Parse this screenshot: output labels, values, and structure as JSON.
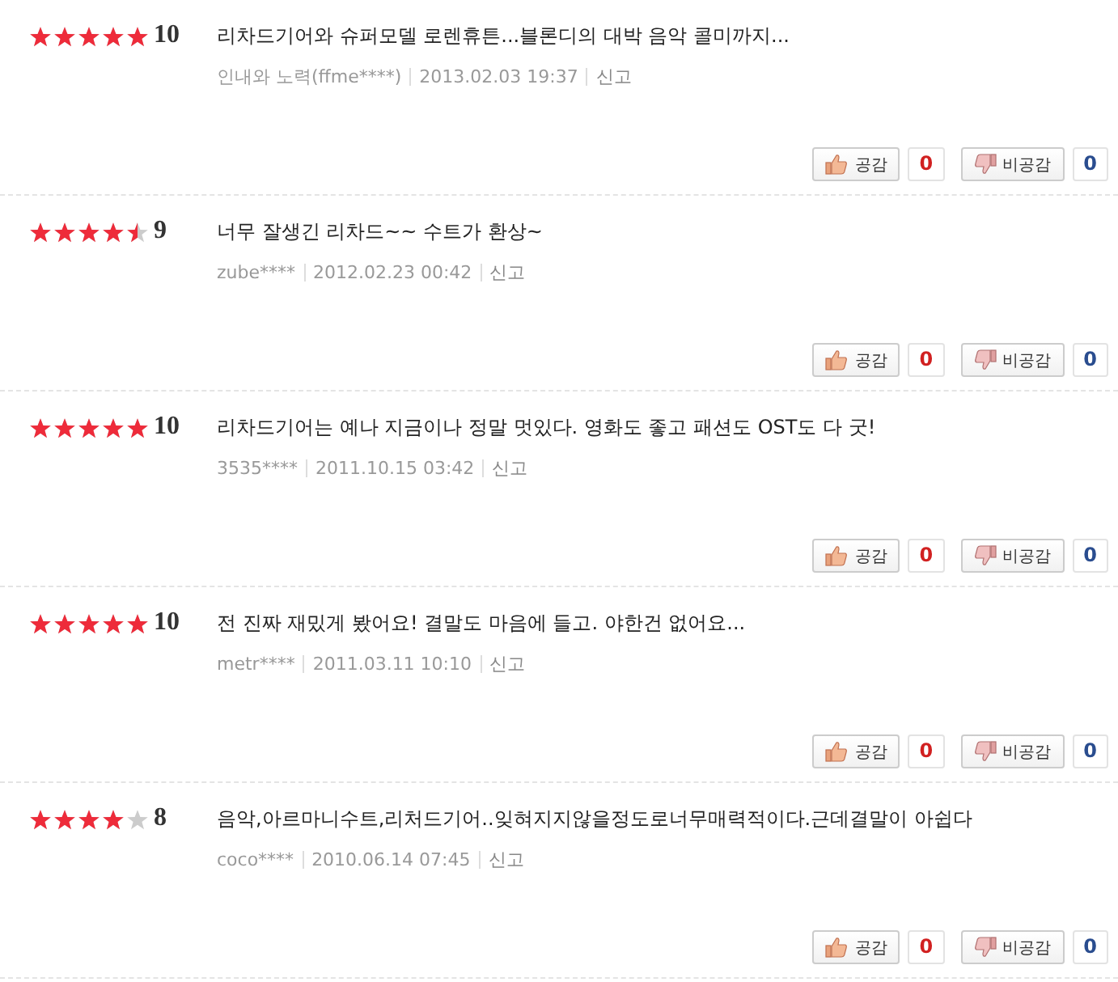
{
  "reviews": [
    {
      "stars": 5,
      "score": "10",
      "text": "리차드기어와 슈퍼모델 로렌휴튼...블론디의 대박 음악 콜미까지...",
      "author": "인내와 노력(ffme****)",
      "date": "2013.02.03 19:37",
      "report": "신고",
      "like_label": "공감",
      "like_count": "0",
      "dislike_label": "비공감",
      "dislike_count": "0"
    },
    {
      "stars": 4.5,
      "score": "9",
      "text": "너무 잘생긴 리차드~~ 수트가 환상~",
      "author": "zube****",
      "date": "2012.02.23 00:42",
      "report": "신고",
      "like_label": "공감",
      "like_count": "0",
      "dislike_label": "비공감",
      "dislike_count": "0"
    },
    {
      "stars": 5,
      "score": "10",
      "text": "리차드기어는 예나 지금이나 정말 멋있다. 영화도 좋고 패션도 OST도 다 굿!",
      "author": "3535****",
      "date": "2011.10.15 03:42",
      "report": "신고",
      "like_label": "공감",
      "like_count": "0",
      "dislike_label": "비공감",
      "dislike_count": "0"
    },
    {
      "stars": 5,
      "score": "10",
      "text": "전 진짜 재밌게 봤어요! 결말도 마음에 들고. 야한건 없어요...",
      "author": "metr****",
      "date": "2011.03.11 10:10",
      "report": "신고",
      "like_label": "공감",
      "like_count": "0",
      "dislike_label": "비공감",
      "dislike_count": "0"
    },
    {
      "stars": 4,
      "score": "8",
      "text": "음악,아르마니수트,리처드기어..잊혀지지않을정도로너무매력적이다.근데결말이 아쉽다",
      "author": "coco****",
      "date": "2010.06.14 07:45",
      "report": "신고",
      "like_label": "공감",
      "like_count": "0",
      "dislike_label": "비공감",
      "dislike_count": "0"
    }
  ]
}
